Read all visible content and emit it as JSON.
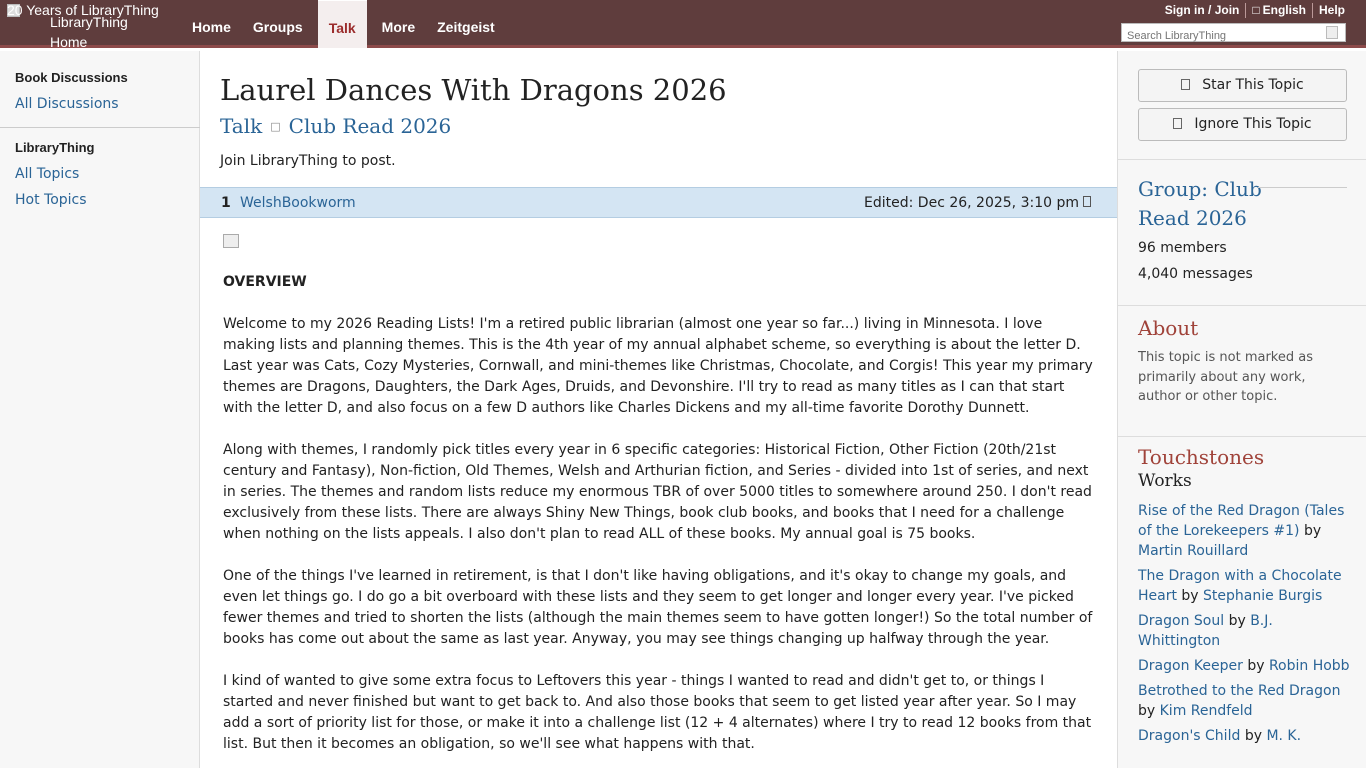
{
  "topbar": {
    "logo_alt": "20 Years of LibraryThing",
    "logo_alt2": "LibraryThing",
    "logo_home": "Home",
    "nav": [
      "Home",
      "Groups",
      "Talk",
      "More",
      "Zeitgeist"
    ],
    "active_nav": "Talk",
    "links": [
      "Sign in / Join",
      "English",
      "Help"
    ],
    "search_placeholder": "Search LibraryThing"
  },
  "leftbar": {
    "section1": "Book Discussions",
    "link1": "All Discussions",
    "section2": "LibraryThing",
    "link2": "All Topics",
    "link3": "Hot Topics"
  },
  "main": {
    "title": "Laurel Dances With Dragons 2026",
    "crumb_talk": "Talk",
    "crumb_group": "Club Read 2026",
    "join": "Join LibraryThing to post.",
    "message": {
      "number": "1",
      "user": "WelshBookworm",
      "edited": "Edited: Dec 26, 2025, 3:10 pm",
      "heading": "OVERVIEW",
      "paragraphs": [
        "Welcome to my 2026 Reading Lists! I'm a retired public librarian (almost one year so far...) living in Minnesota. I love making lists and planning themes. This is the 4th year of my annual alphabet scheme, so everything is about the letter D. Last year was Cats, Cozy Mysteries, Cornwall, and mini-themes like Christmas, Chocolate, and Corgis! This year my primary themes are Dragons, Daughters, the Dark Ages, Druids, and Devonshire. I'll try to read as many titles as I can that start with the letter D, and also focus on a few D authors like Charles Dickens and my all-time favorite Dorothy Dunnett.",
        "Along with themes, I randomly pick titles every year in 6 specific categories: Historical Fiction, Other Fiction (20th/21st century and Fantasy), Non-fiction, Old Themes, Welsh and Arthurian fiction, and Series - divided into 1st of series, and next in series. The themes and random lists reduce my enormous TBR of over 5000 titles to somewhere around 250. I don't read exclusively from these lists. There are always Shiny New Things, book club books, and books that I need for a challenge when nothing on the lists appeals. I also don't plan to read ALL of these books. My annual goal is 75 books.",
        "One of the things I've learned in retirement, is that I don't like having obligations, and it's okay to change my goals, and even let things go. I do go a bit overboard with these lists and they seem to get longer and longer every year. I've picked fewer themes and tried to shorten the lists (although the main themes seem to have gotten longer!) So the total number of books has come out about the same as last year. Anyway, you may see things changing up halfway through the year.",
        "I kind of wanted to give some extra focus to Leftovers this year - things I wanted to read and didn't get to, or things I started and never finished but want to get back to. And also those books that seem to get listed year after year. So I may add a sort of priority list for those, or make it into a challenge list (12 + 4 alternates) where I try to read 12 books from that list. But then it becomes an obligation, so we'll see what happens with that."
      ]
    }
  },
  "rightbar": {
    "star": "Star This Topic",
    "ignore": "Ignore This Topic",
    "group_title_1": "Group: Club",
    "group_title_2": "Read 2026",
    "members": "96 members",
    "messages": "4,040 messages",
    "about_title": "About",
    "about_text": "This topic is not marked as primarily about any work, author or other topic.",
    "touch_title": "Touchstones",
    "works": "Works",
    "by": "by",
    "touchstones": [
      {
        "title": "Rise of the Red Dragon (Tales of the Lorekeepers #1)",
        "author": "Martin Rouillard"
      },
      {
        "title": "The Dragon with a Chocolate Heart",
        "author": "Stephanie Burgis"
      },
      {
        "title": "Dragon Soul",
        "author": "B.J. Whittington"
      },
      {
        "title": "Dragon Keeper",
        "author": "Robin Hobb"
      },
      {
        "title": "Betrothed to the Red Dragon",
        "author": "Kim Rendfeld"
      },
      {
        "title": "Dragon's Child",
        "author": "M. K."
      }
    ]
  }
}
